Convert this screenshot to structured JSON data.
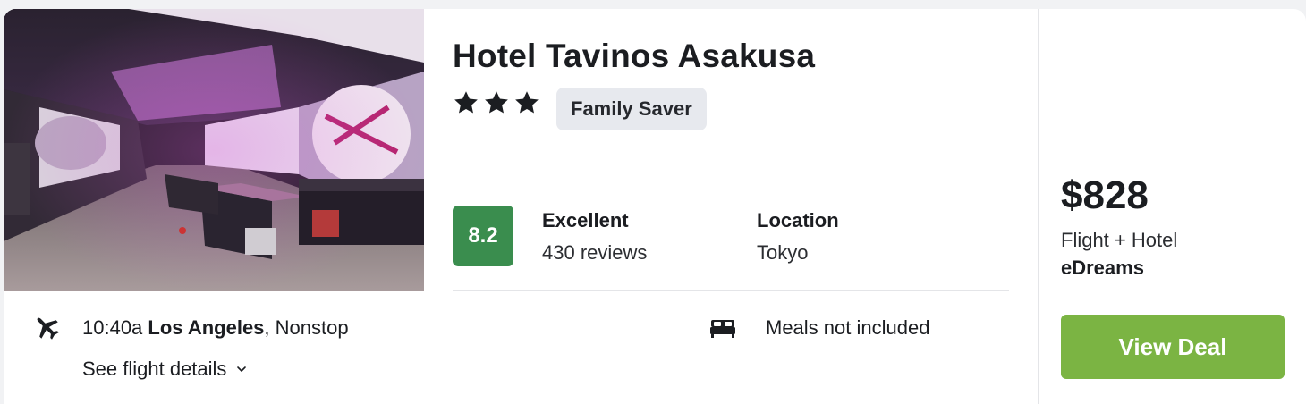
{
  "hotel": {
    "name": "Hotel Tavinos Asakusa",
    "star_count": 3,
    "badge": "Family Saver"
  },
  "rating": {
    "score": "8.2",
    "label": "Excellent",
    "reviews": "430 reviews"
  },
  "location": {
    "label": "Location",
    "value": "Tokyo"
  },
  "flight": {
    "time": "10:40a",
    "city": "Los Angeles",
    "stops": ", Nonstop",
    "details_link": "See flight details"
  },
  "meals": "Meals not included",
  "offer": {
    "price": "$828",
    "package": "Flight + Hotel",
    "provider": "eDreams",
    "cta": "View Deal"
  },
  "icons": {
    "star": "star-icon",
    "plane": "plane-icon",
    "bed": "bed-icon",
    "chevron": "chevron-down-icon"
  },
  "colors": {
    "score_bg": "#3a8d4e",
    "cta_bg": "#7bb443",
    "badge_bg": "#e7e9ee",
    "text": "#1b1d21"
  }
}
